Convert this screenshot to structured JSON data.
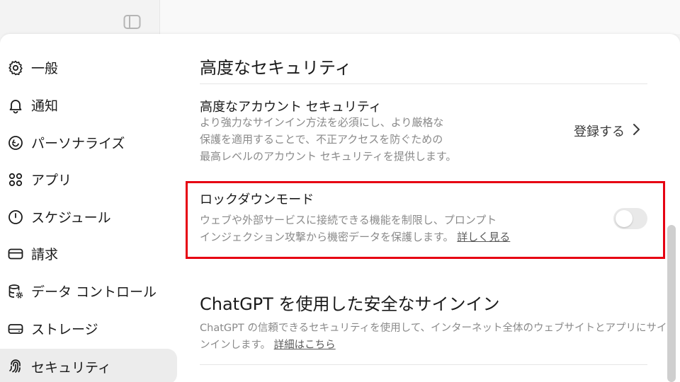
{
  "nav": {
    "items": [
      {
        "label": "一般",
        "icon": "gear-icon"
      },
      {
        "label": "通知",
        "icon": "bell-icon"
      },
      {
        "label": "パーソナライズ",
        "icon": "personalize-icon"
      },
      {
        "label": "アプリ",
        "icon": "apps-icon"
      },
      {
        "label": "スケジュール",
        "icon": "clock-icon"
      },
      {
        "label": "請求",
        "icon": "card-icon"
      },
      {
        "label": "データ コントロール",
        "icon": "database-gear-icon"
      },
      {
        "label": "ストレージ",
        "icon": "storage-icon"
      },
      {
        "label": "セキュリティ",
        "icon": "fingerprint-icon",
        "active": true
      }
    ]
  },
  "main": {
    "section_title": "高度なセキュリティ",
    "advanced_account": {
      "title": "高度なアカウント セキュリティ",
      "desc_line1": "より強力なサインイン方法を必須にし、より厳格な",
      "desc_line2": "保護を適用することで、不正アクセスを防ぐための",
      "desc_line3": "最高レベルのアカウント セキュリティを提供します。",
      "action_label": "登録する"
    },
    "lockdown": {
      "title": "ロックダウンモード",
      "desc_line1": "ウェブや外部サービスに接続できる機能を制限し、プロンプト",
      "desc_line2": "インジェクション攻撃から機密データを保護します。",
      "link": "詳しく見る",
      "toggle_on": false
    },
    "safe_signin": {
      "title": "ChatGPT を使用した安全なサインイン",
      "desc_line1": "ChatGPT の信頼できるセキュリティを使用して、インターネット全体のウェブサイトとアプリにサイ",
      "desc_line2": "ンインします。",
      "link": "詳細はこちら"
    }
  },
  "colors": {
    "highlight_border": "#e60012",
    "active_nav_bg": "#ececec",
    "toggle_off": "#e9e9e9"
  }
}
